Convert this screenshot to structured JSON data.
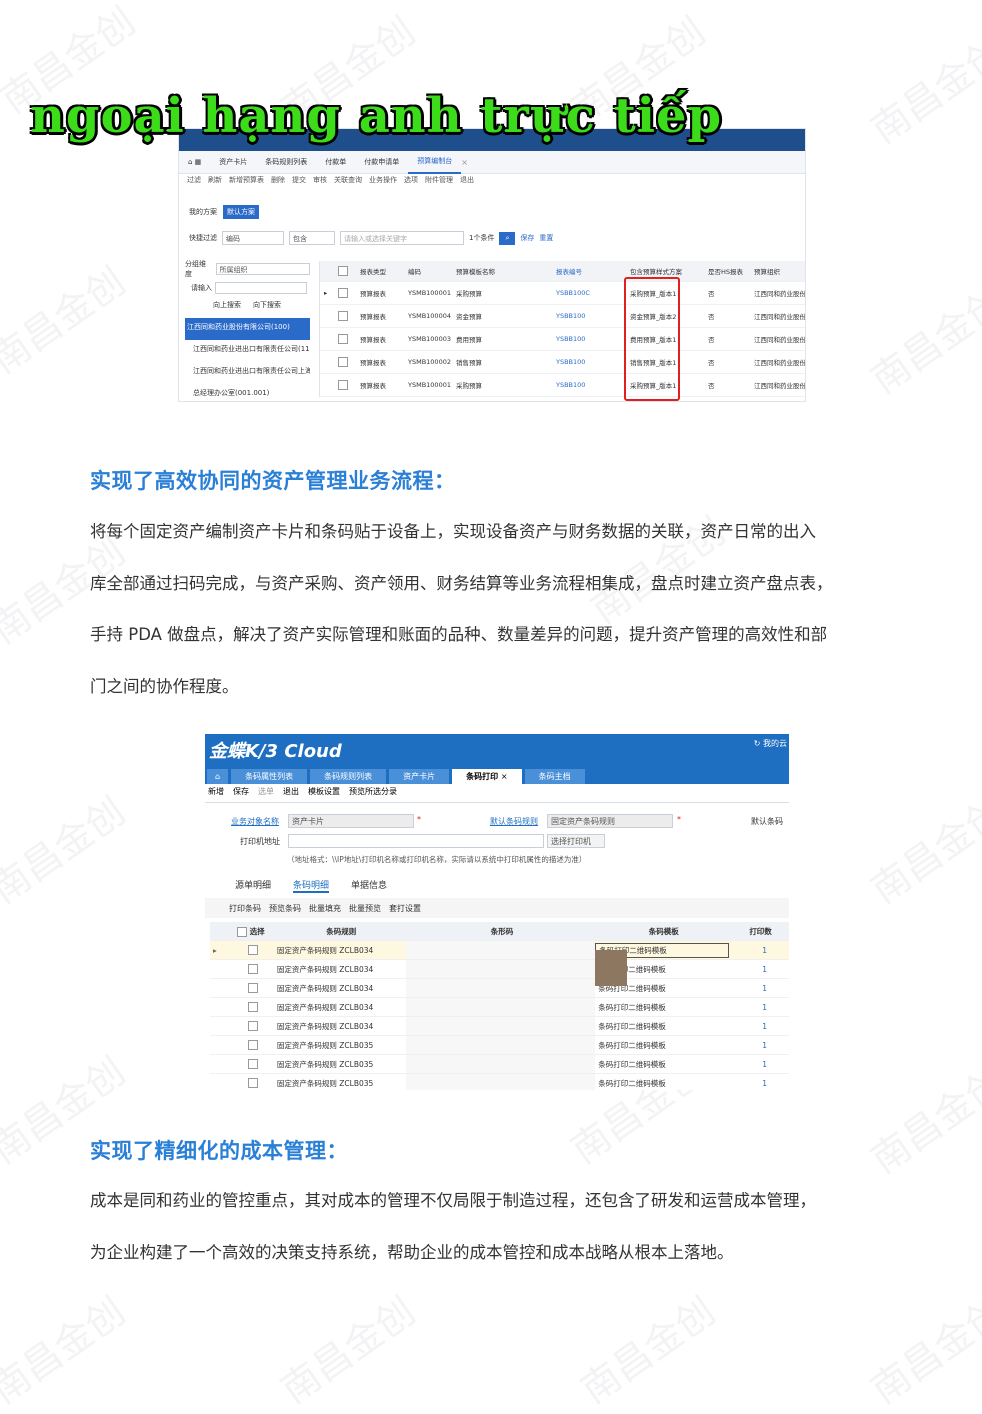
{
  "banner_text": "ngoại hạng anh trực tiếp",
  "watermark": "南昌金创",
  "shot1": {
    "tabs": [
      "资产卡片",
      "条码规则列表",
      "付款单",
      "付款申请单",
      "预算编制台"
    ],
    "active_tab_index": 4,
    "toolbar": [
      "过滤",
      "刷新",
      "新增预算表",
      "删除",
      "提交",
      "审核",
      "关联查询",
      "业务操作",
      "选项",
      "附件管理",
      "退出"
    ],
    "plan_label": "我的方案",
    "plan_default": "默认方案",
    "filter_label": "快捷过滤",
    "filter_field": "编码",
    "filter_op": "包含",
    "filter_placeholder": "请输入或选择关键字",
    "filter_count": "1个条件",
    "save": "保存",
    "reset": "重置",
    "group_label": "分组维度",
    "group_value": "所属组织",
    "input_label": "请输入",
    "search_up": "向上搜索",
    "search_down": "向下搜索",
    "tree": [
      "江西同和药业股份有限公司(100)",
      "江西同和药业进出口有限责任公司(110)",
      "江西同和药业进出口有限责任公司上海分公司",
      "总经理办公室(001.001)"
    ],
    "columns": [
      "报表类型",
      "编码",
      "预算模板名称",
      "报表编号",
      "包含预算样式方案",
      "是否HS报表",
      "预算组织"
    ],
    "rows": [
      [
        "预算报表",
        "YSMB100001",
        "采购预算",
        "YSBB100C",
        "采购预算_版本1",
        "否",
        "江西同和药业股份有"
      ],
      [
        "预算报表",
        "YSMB100004",
        "资金预算",
        "YSBB100",
        "资金预算_版本2",
        "否",
        "江西同和药业股份有"
      ],
      [
        "预算报表",
        "YSMB100003",
        "费用预算",
        "YSBB100",
        "费用预算_版本1",
        "否",
        "江西同和药业股份有"
      ],
      [
        "预算报表",
        "YSMB100002",
        "销售预算",
        "YSBB100",
        "销售预算_版本1",
        "否",
        "江西同和药业股份有"
      ],
      [
        "预算报表",
        "YSMB100001",
        "采购预算",
        "YSBB100",
        "采购预算_版本1",
        "否",
        "江西同和药业股份有"
      ]
    ]
  },
  "section1": {
    "heading": "实现了高效协同的资产管理业务流程：",
    "lines": [
      "将每个固定资产编制资产卡片和条码贴于设备上，实现设备资产与财务数据的关联，资产日常的出入",
      "库全部通过扫码完成，与资产采购、资产领用、财务结算等业务流程相集成，盘点时建立资产盘点表，",
      "手持 PDA 做盘点，解决了资产实际管理和账面的品种、数量差异的问题，提升资产管理的高效性和部",
      "门之间的协作程度。"
    ]
  },
  "shot2": {
    "logo": "金蝶K/3 Cloud",
    "top_right": "我的云",
    "tabs": [
      "条码属性列表",
      "条码规则列表",
      "资产卡片",
      "条码打印",
      "条码主档"
    ],
    "active_tab_index": 3,
    "toolbar": [
      "新增",
      "保存",
      "选单",
      "退出",
      "模板设置",
      "预览所选分录"
    ],
    "biz_label": "业务对象名称",
    "biz_value": "资产卡片",
    "rule_label": "默认条码规则",
    "rule_value": "固定资产条码规则",
    "default_label": "默认条码",
    "printer_label": "打印机地址",
    "printer_button": "选择打印机",
    "printer_hint": "（地址格式：\\\\IP地址\\打印机名称或打印机名称，实际请以系统中打印机属性的描述为准）",
    "subtabs": [
      "源单明细",
      "条码明细",
      "单据信息"
    ],
    "active_subtab_index": 1,
    "subtool": [
      "打印条码",
      "预览条码",
      "批量填充",
      "批量预览",
      "套打设置"
    ],
    "columns": [
      "选择",
      "条码规则",
      "条形码",
      "条码模板",
      "打印数"
    ],
    "rows": [
      [
        "固定资产条码规则",
        "ZCLB034",
        "条码打印二维码模板",
        "1"
      ],
      [
        "固定资产条码规则",
        "ZCLB034",
        "条码打印二维码模板",
        "1"
      ],
      [
        "固定资产条码规则",
        "ZCLB034",
        "条码打印二维码模板",
        "1"
      ],
      [
        "固定资产条码规则",
        "ZCLB034",
        "条码打印二维码模板",
        "1"
      ],
      [
        "固定资产条码规则",
        "ZCLB034",
        "条码打印二维码模板",
        "1"
      ],
      [
        "固定资产条码规则",
        "ZCLB035",
        "条码打印二维码模板",
        "1"
      ],
      [
        "固定资产条码规则",
        "ZCLB035",
        "条码打印二维码模板",
        "1"
      ],
      [
        "固定资产条码规则",
        "ZCLB035",
        "条码打印二维码模板",
        "1"
      ]
    ]
  },
  "section2": {
    "heading": "实现了精细化的成本管理：",
    "lines": [
      "成本是同和药业的管控重点，其对成本的管理不仅局限于制造过程，还包含了研发和运营成本管理，",
      "为企业构建了一个高效的决策支持系统，帮助企业的成本管控和成本战略从根本上落地。"
    ]
  },
  "colors": {
    "heading": "#2a7fd6",
    "banner": "#3ddc1a",
    "k3_blue": "#1e6fc1",
    "highlight": "#e02020"
  }
}
